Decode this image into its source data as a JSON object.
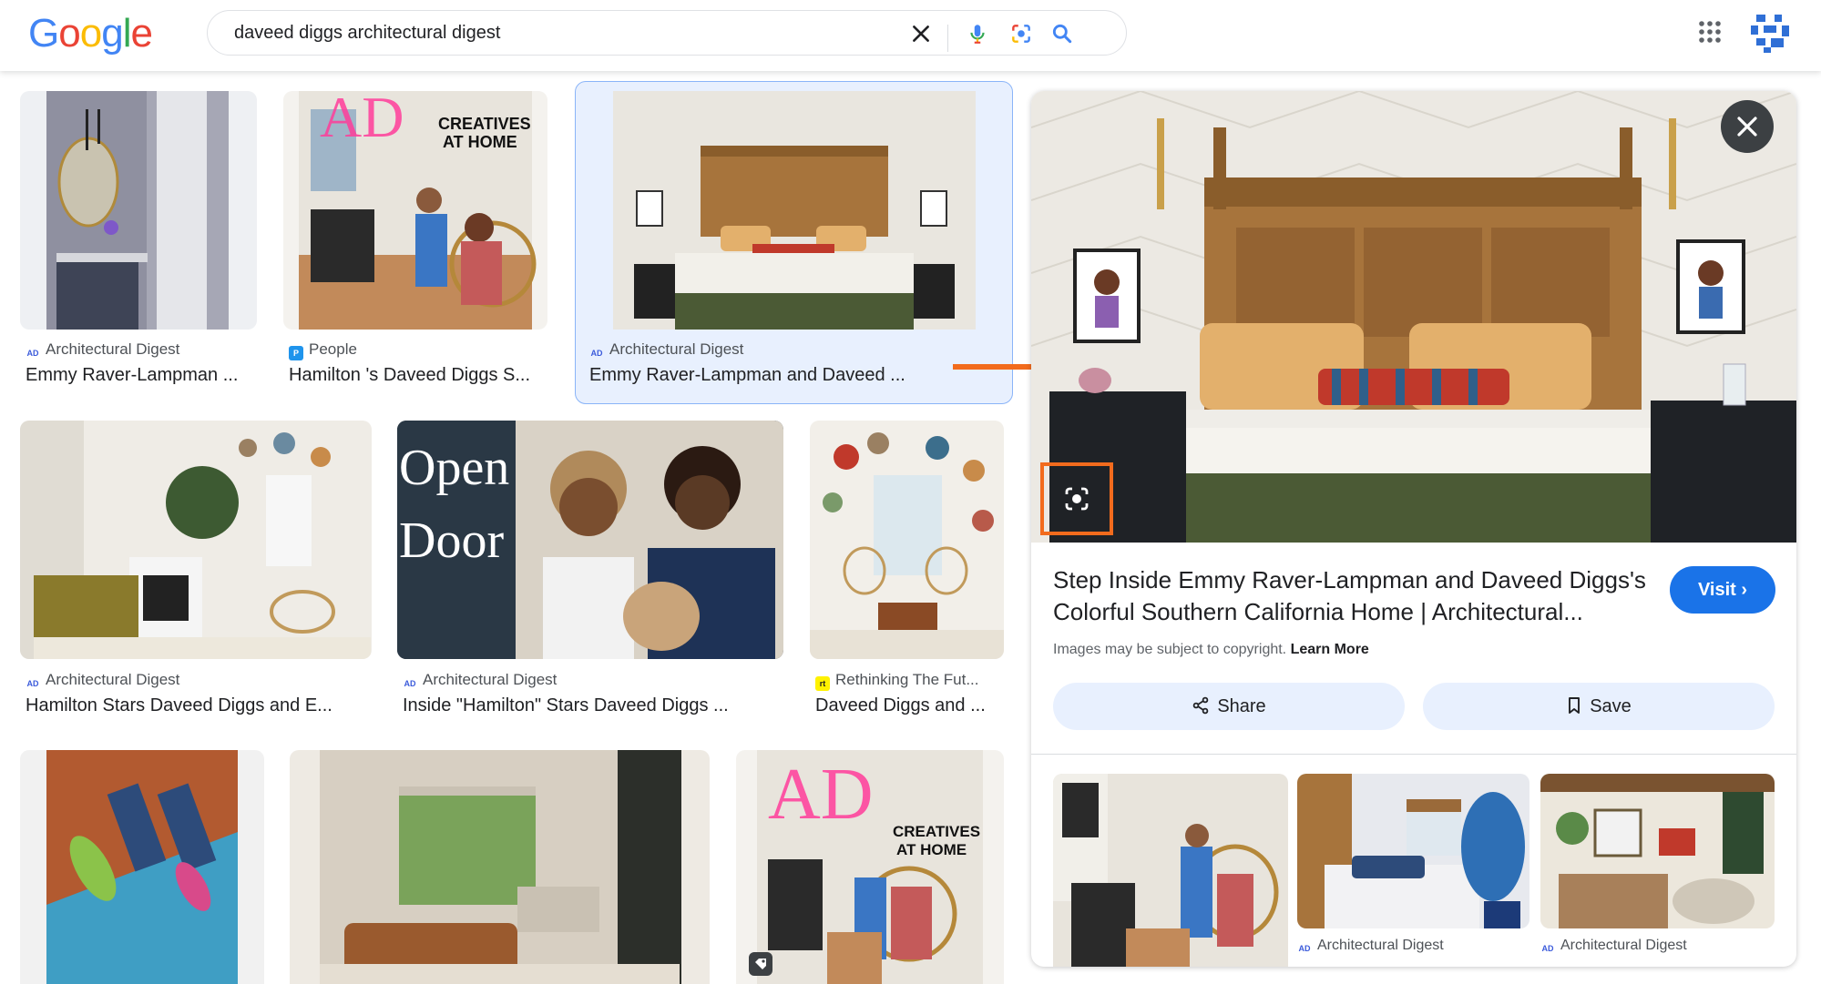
{
  "header": {
    "logo": "Google",
    "search_value": "daveed diggs architectural digest"
  },
  "results": [
    {
      "source": "Architectural Digest",
      "title": "Emmy Raver-Lampman ..."
    },
    {
      "source": "People",
      "title": "Hamilton 's Daveed Diggs S..."
    },
    {
      "source": "Architectural Digest",
      "title": "Emmy Raver-Lampman and Daveed ..."
    },
    {
      "source": "Architectural Digest",
      "title": "Hamilton Stars Daveed Diggs and E..."
    },
    {
      "source": "Architectural Digest",
      "title": "Inside \"Hamilton\" Stars Daveed Diggs ..."
    },
    {
      "source": "Rethinking The Fut...",
      "title": "Daveed Diggs and ..."
    }
  ],
  "thumb_text": {
    "creatives": "CREATIVES",
    "at_home": "AT HOME",
    "open": "Open",
    "door": "Door"
  },
  "panel": {
    "title": "Step Inside Emmy Raver-Lampman and Daveed Diggs's Colorful Southern California Home | Architectural...",
    "visit_label": "Visit ›",
    "copyright": "Images may be subject to copyright.",
    "learn_more": "Learn More",
    "share_label": "Share",
    "save_label": "Save",
    "related": [
      {
        "source": ""
      },
      {
        "source": "Architectural Digest"
      },
      {
        "source": "Architectural Digest"
      }
    ]
  },
  "colors": {
    "accent": "#1a73e8",
    "selected_bg": "#e8f0fe",
    "annotation": "#f26b1d"
  }
}
